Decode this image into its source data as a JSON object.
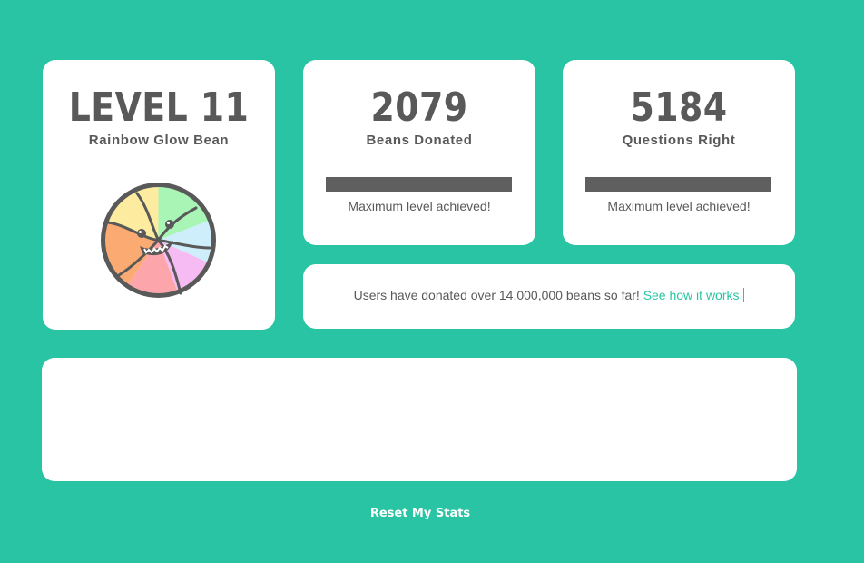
{
  "level_card": {
    "level_text": "LEVEL 11",
    "bean_name": "Rainbow Glow Bean",
    "icon": "rainbow-bean-icon"
  },
  "beans_card": {
    "value": "2079",
    "label": "Beans Donated",
    "progress_fraction": 1.0,
    "caption": "Maximum level achieved!"
  },
  "questions_card": {
    "value": "5184",
    "label": "Questions Right",
    "progress_fraction": 1.0,
    "caption": "Maximum level achieved!"
  },
  "info": {
    "text": "Users have donated over 14,000,000 beans so far!",
    "link_text": "See how it works."
  },
  "footer": {
    "reset_label": "Reset My Stats"
  },
  "colors": {
    "background": "#28c4a3",
    "card": "#ffffff",
    "text": "#595959",
    "link": "#28c4a3",
    "progress_fill": "#5f5f5f"
  }
}
